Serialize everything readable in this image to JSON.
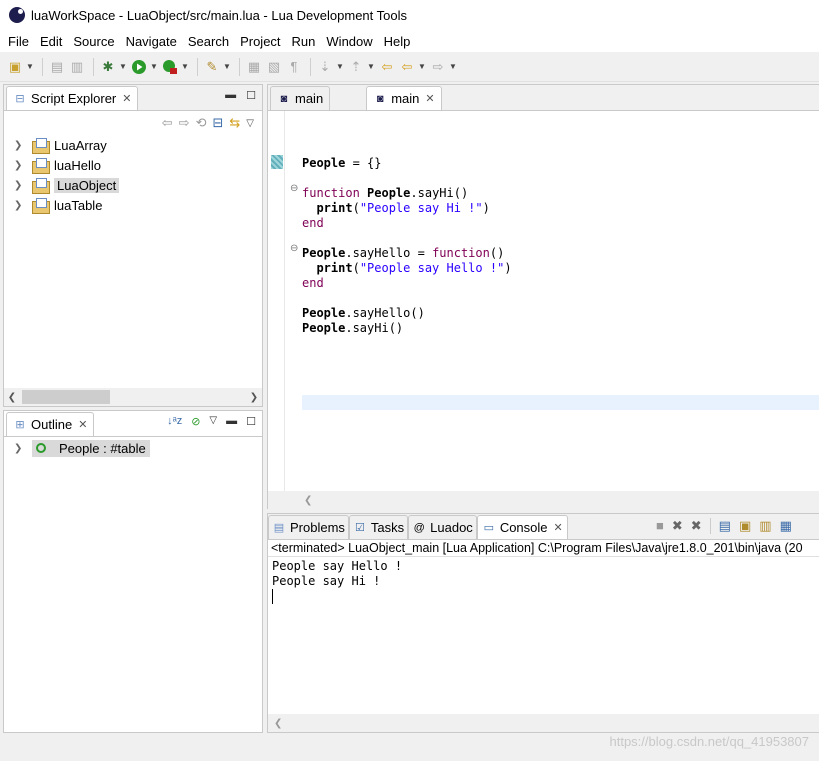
{
  "window": {
    "title": "luaWorkSpace - LuaObject/src/main.lua - Lua Development Tools"
  },
  "menu": [
    "File",
    "Edit",
    "Source",
    "Navigate",
    "Search",
    "Project",
    "Run",
    "Window",
    "Help"
  ],
  "script_explorer": {
    "tab_label": "Script Explorer",
    "items": [
      {
        "label": "LuaArray"
      },
      {
        "label": "luaHello"
      },
      {
        "label": "LuaObject"
      },
      {
        "label": "luaTable"
      }
    ]
  },
  "outline": {
    "tab_label": "Outline",
    "items": [
      {
        "label": "People : #table"
      }
    ]
  },
  "editor": {
    "tabs": [
      {
        "label": "main"
      },
      {
        "label": "main"
      }
    ],
    "lines": [
      {
        "tokens": []
      },
      {
        "tokens": []
      },
      {
        "tokens": []
      },
      {
        "tokens": [
          {
            "t": "People",
            "c": "bold"
          },
          {
            "t": " = {}",
            "c": ""
          }
        ]
      },
      {
        "tokens": []
      },
      {
        "tokens": [
          {
            "t": "function",
            "c": "kw"
          },
          {
            "t": " ",
            "c": ""
          },
          {
            "t": "People",
            "c": "bold"
          },
          {
            "t": ".sayHi()",
            "c": ""
          }
        ]
      },
      {
        "tokens": [
          {
            "t": "  print",
            "c": "bold"
          },
          {
            "t": "(",
            "c": ""
          },
          {
            "t": "\"People say Hi !\"",
            "c": "str"
          },
          {
            "t": ")",
            "c": ""
          }
        ]
      },
      {
        "tokens": [
          {
            "t": "end",
            "c": "kw"
          }
        ]
      },
      {
        "tokens": []
      },
      {
        "tokens": [
          {
            "t": "People",
            "c": "bold"
          },
          {
            "t": ".sayHello = ",
            "c": ""
          },
          {
            "t": "function",
            "c": "kw"
          },
          {
            "t": "()",
            "c": ""
          }
        ]
      },
      {
        "tokens": [
          {
            "t": "  print",
            "c": "bold"
          },
          {
            "t": "(",
            "c": ""
          },
          {
            "t": "\"People say Hello !\"",
            "c": "str"
          },
          {
            "t": ")",
            "c": ""
          }
        ]
      },
      {
        "tokens": [
          {
            "t": "end",
            "c": "kw"
          }
        ]
      },
      {
        "tokens": []
      },
      {
        "tokens": [
          {
            "t": "People",
            "c": "bold"
          },
          {
            "t": ".sayHello()",
            "c": ""
          }
        ]
      },
      {
        "tokens": [
          {
            "t": "People",
            "c": "bold"
          },
          {
            "t": ".sayHi()",
            "c": ""
          }
        ]
      }
    ]
  },
  "console_view": {
    "tabs": [
      {
        "label": "Problems"
      },
      {
        "label": "Tasks"
      },
      {
        "label": "Luadoc"
      },
      {
        "label": "Console"
      }
    ],
    "status": "<terminated> LuaObject_main [Lua Application] C:\\Program Files\\Java\\jre1.8.0_201\\bin\\java (20",
    "output": [
      "People say Hello !",
      "People say Hi !"
    ]
  },
  "watermark": "https://blog.csdn.net/qq_41953807"
}
